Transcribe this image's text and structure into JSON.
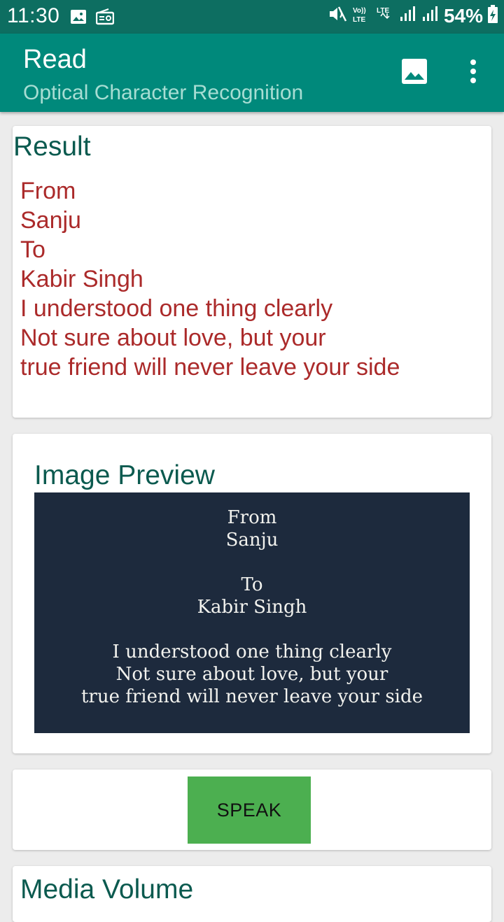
{
  "status_bar": {
    "time": "11:30",
    "battery": "54%",
    "icons": [
      "image-notification-icon",
      "radio-icon",
      "mute-icon",
      "volte-icon",
      "lte-icon",
      "signal-icon",
      "signal-icon",
      "battery-charging-icon"
    ]
  },
  "app_bar": {
    "title": "Read",
    "subtitle": "Optical Character Recognition",
    "actions": [
      "gallery-icon",
      "overflow-menu-icon"
    ]
  },
  "result": {
    "heading": "Result",
    "lines": [
      "From",
      "Sanju",
      "To",
      "Kabir Singh",
      "I understood one thing clearly",
      "Not sure about love, but your",
      "true friend will never leave your side"
    ]
  },
  "preview": {
    "heading": "Image Preview",
    "image_lines": [
      "From",
      "Sanju",
      "",
      "To",
      "Kabir Singh",
      "",
      "I understood one thing clearly",
      "Not sure about love, but your",
      "true friend will never leave your side"
    ]
  },
  "speak": {
    "label": "SPEAK"
  },
  "volume": {
    "heading": "Media Volume"
  },
  "colors": {
    "status_bar": "#0d6e61",
    "app_bar": "#00897b",
    "heading": "#0b5a4f",
    "result_text": "#ab2a2a",
    "speak_button": "#4caf50",
    "preview_bg": "#1d2a3d"
  }
}
